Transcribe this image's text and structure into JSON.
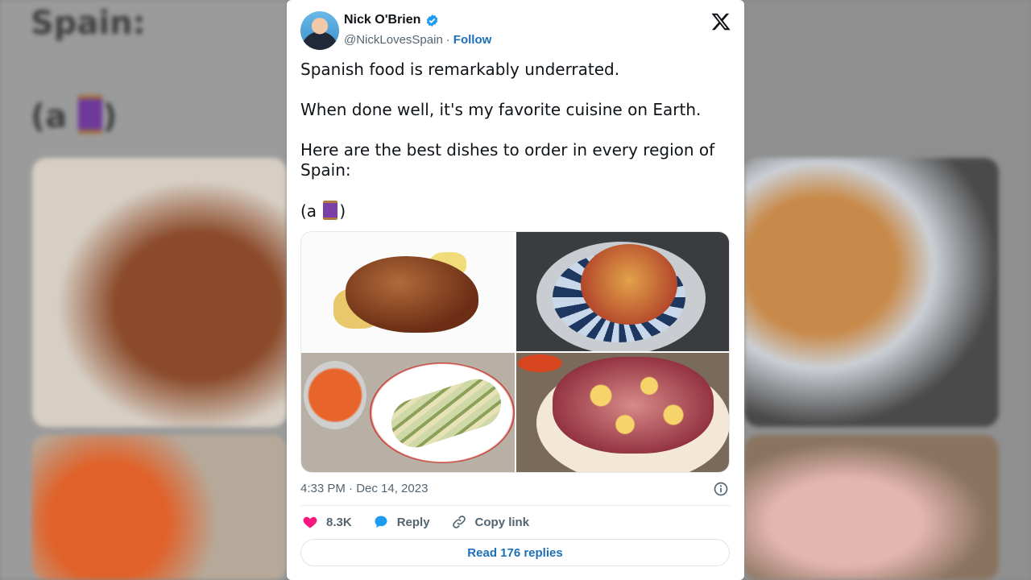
{
  "background": {
    "left_heading": "Spain:",
    "left_line": "(a ",
    "left_line_close": ")"
  },
  "tweet": {
    "author_name": "Nick O'Brien",
    "author_handle": "@NickLovesSpain",
    "separator": "·",
    "follow_label": "Follow",
    "paragraphs": [
      "Spanish food is remarkably underrated.",
      "When done well, it's my favorite cuisine on Earth.",
      "Here are the best dishes to order in every region of Spain:"
    ],
    "thread_open": "(a ",
    "thread_close": ")",
    "timestamp": "4:33 PM · Dec 14, 2023",
    "likes_count": "8.3K",
    "reply_label": "Reply",
    "copy_link_label": "Copy link",
    "read_replies_label": "Read 176 replies"
  },
  "icons": {
    "verified": "verified-badge-icon",
    "close": "x-logo-icon",
    "thread": "spool-of-thread-icon",
    "like": "heart-icon",
    "reply": "speech-bubble-icon",
    "copy": "link-icon",
    "info": "info-icon"
  },
  "colors": {
    "accent": "#1d70b8",
    "verified": "#1d9bf0",
    "like": "#f91880",
    "text": "#0f1419",
    "secondary": "#536471"
  }
}
